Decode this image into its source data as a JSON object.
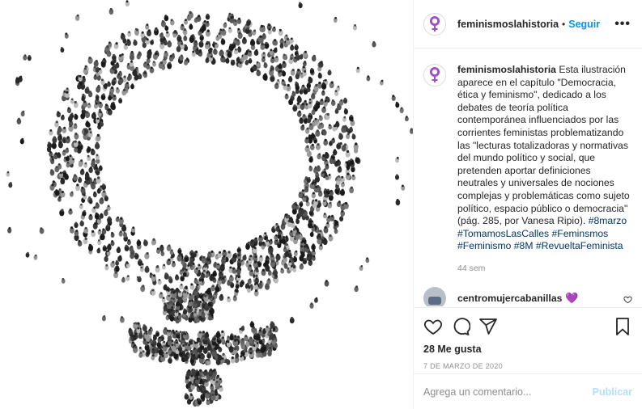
{
  "post": {
    "image_alt": "",
    "accent_color": "#0095f6",
    "hashtag_color": "#00376b"
  },
  "header": {
    "username": "feminismoslahistoria",
    "separator": "•",
    "follow_label": "Seguir",
    "more_icon": "ellipsis-icon",
    "more_label": "•••"
  },
  "caption": {
    "username": "feminismoslahistoria",
    "text": "Esta ilustración aparece en el capítulo \"Democracia, ética y feminismo\", dedicado a los debates de teoría política contemporánea influenciados por las corrientes feministas problematizando las \"lecturas totalizadoras y normativas del mundo político y social, que pretenden aportar definiciones neutrales y universales de nociones complejas y problemáticas como sujeto político, espacio público o democracia\" (pág. 285, por Vanesa Ripio).",
    "hashtags": [
      "#8marzo",
      "#TomamosLasCalles",
      "#Feminsmos",
      "#Feminismo",
      "#8M",
      "#RevueltaFeminista"
    ],
    "time": "44 sem"
  },
  "comment": {
    "username": "centromujercabanillas",
    "emoji": "💜"
  },
  "actions": {
    "like_icon": "heart-icon",
    "comment_icon": "comment-icon",
    "share_icon": "paper-plane-icon",
    "save_icon": "bookmark-icon",
    "likes": "28 Me gusta",
    "date": "7 DE MARZO DE 2020"
  },
  "composer": {
    "placeholder": "Agrega un comentario...",
    "publish_label": "Publicar",
    "publish_color": "#b2dffc"
  }
}
